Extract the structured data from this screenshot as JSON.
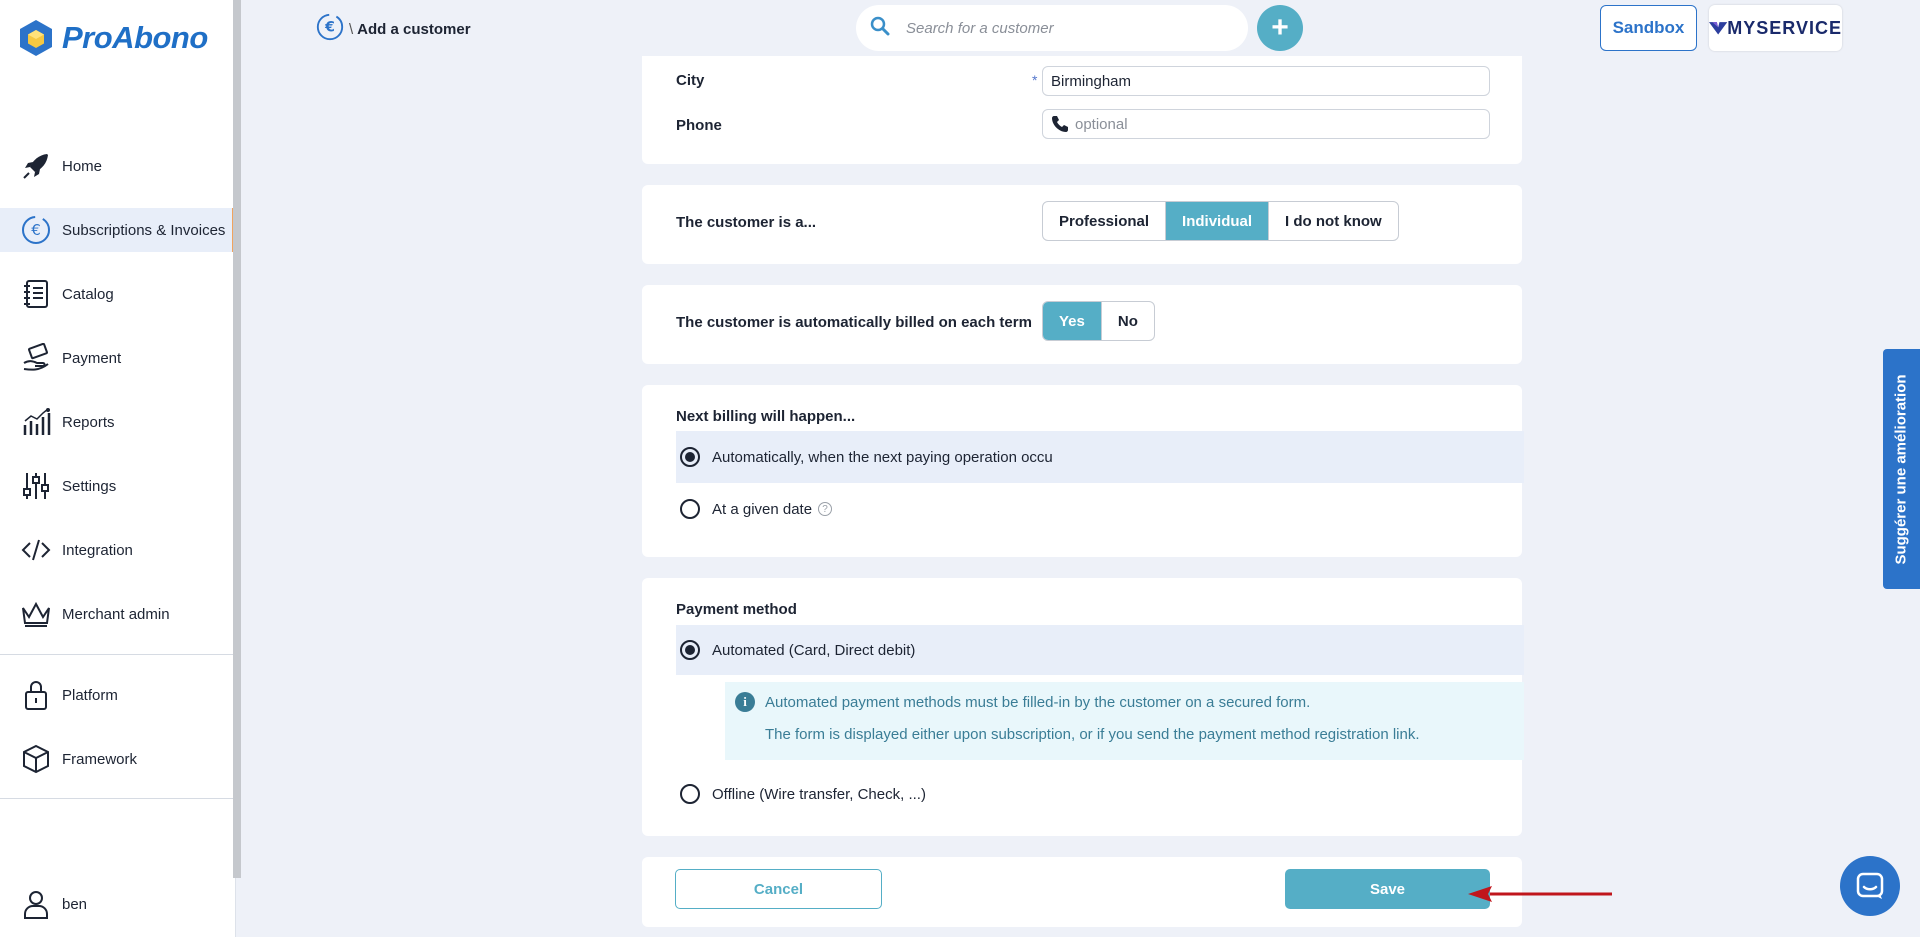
{
  "app": {
    "name": "ProAbono"
  },
  "sidebar": {
    "items": [
      {
        "label": "Home",
        "icon": "rocket-icon"
      },
      {
        "label": "Subscriptions & Invoices",
        "icon": "euro-cycle-icon",
        "active": true
      },
      {
        "label": "Catalog",
        "icon": "notebook-icon"
      },
      {
        "label": "Payment",
        "icon": "hand-money-icon"
      },
      {
        "label": "Reports",
        "icon": "bar-chart-icon"
      },
      {
        "label": "Settings",
        "icon": "sliders-icon"
      },
      {
        "label": "Integration",
        "icon": "code-icon"
      },
      {
        "label": "Merchant admin",
        "icon": "crown-icon"
      },
      {
        "label": "Platform",
        "icon": "lock-icon"
      },
      {
        "label": "Framework",
        "icon": "cube-icon"
      }
    ],
    "user": {
      "name": "ben",
      "icon": "user-icon"
    }
  },
  "header": {
    "breadcrumb_sep": "\\",
    "breadcrumb_title": "Add a customer",
    "search_placeholder": "Search for a customer",
    "add_label": "+",
    "sandbox_label": "Sandbox",
    "service_label": "MYSERVICE"
  },
  "address": {
    "city_label": "City",
    "city_value": "Birmingham",
    "required_mark": "*",
    "phone_label": "Phone",
    "phone_placeholder": "optional"
  },
  "customer_type": {
    "label": "The customer is a...",
    "options": [
      "Professional",
      "Individual",
      "I do not know"
    ],
    "selected": "Individual"
  },
  "auto_billing": {
    "label": "The customer is automatically billed on each term",
    "options": [
      "Yes",
      "No"
    ],
    "selected": "Yes"
  },
  "next_billing": {
    "label": "Next billing will happen...",
    "options": [
      "Automatically, when the next paying operation occu",
      "At a given date"
    ],
    "selected_index": 0
  },
  "payment_method": {
    "label": "Payment method",
    "options": [
      "Automated (Card, Direct debit)",
      "Offline (Wire transfer, Check, ...)"
    ],
    "selected_index": 0,
    "info_line1": "Automated payment methods must be filled-in by the customer on a secured form.",
    "info_line2": "The form is displayed either upon subscription, or if you send the payment method registration link."
  },
  "actions": {
    "cancel_label": "Cancel",
    "save_label": "Save"
  },
  "feedback": {
    "label": "Suggérer une amélioration"
  },
  "colors": {
    "accent": "#55aec6",
    "brand": "#2c73c9",
    "active_border": "#f0a35e",
    "arrow": "#c0161c"
  }
}
